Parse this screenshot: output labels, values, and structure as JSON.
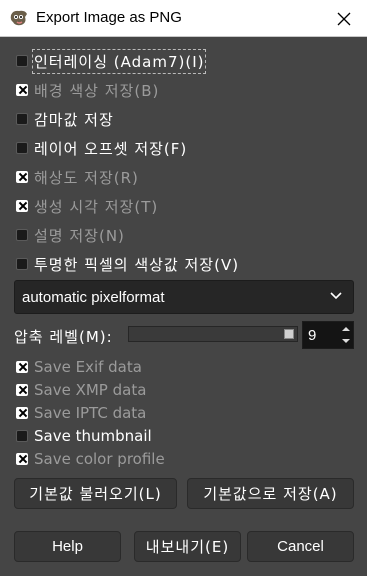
{
  "window": {
    "title": "Export Image as PNG"
  },
  "options": [
    {
      "label": "인터레이싱 (Adam7)(I)",
      "checked": false,
      "enabled": true,
      "korean": true,
      "focused": true
    },
    {
      "label": "배경 색상 저장(B)",
      "checked": true,
      "enabled": false,
      "korean": true
    },
    {
      "label": "감마값 저장",
      "checked": false,
      "enabled": true,
      "korean": true
    },
    {
      "label": "레이어 오프셋 저장(F)",
      "checked": false,
      "enabled": true,
      "korean": true
    },
    {
      "label": "해상도 저장(R)",
      "checked": true,
      "enabled": false,
      "korean": true
    },
    {
      "label": "생성 시각 저장(T)",
      "checked": true,
      "enabled": false,
      "korean": true
    },
    {
      "label": "설명 저장(N)",
      "checked": false,
      "enabled": false,
      "korean": true
    },
    {
      "label": "투명한 픽셀의 색상값 저장(V)",
      "checked": false,
      "enabled": true,
      "korean": true
    }
  ],
  "format": {
    "value": "automatic pixelformat"
  },
  "compression": {
    "label": "압축 레벨(M):",
    "value": "9",
    "level": 9,
    "max": 9
  },
  "metadata": [
    {
      "label": "Save Exif data",
      "checked": true,
      "enabled": false
    },
    {
      "label": "Save XMP data",
      "checked": true,
      "enabled": false
    },
    {
      "label": "Save IPTC data",
      "checked": true,
      "enabled": false
    },
    {
      "label": "Save thumbnail",
      "checked": false,
      "enabled": true
    },
    {
      "label": "Save color profile",
      "checked": true,
      "enabled": false
    }
  ],
  "buttons": {
    "load_defaults": "기본값 불러오기(L)",
    "save_defaults": "기본값으로 저장(A)",
    "help": "Help",
    "export": "내보내기(E)",
    "cancel": "Cancel"
  },
  "colors": {
    "background": "#454545",
    "text": "#ffffff",
    "disabled_text": "#9b9b9b",
    "titlebar": "#ffffff"
  }
}
